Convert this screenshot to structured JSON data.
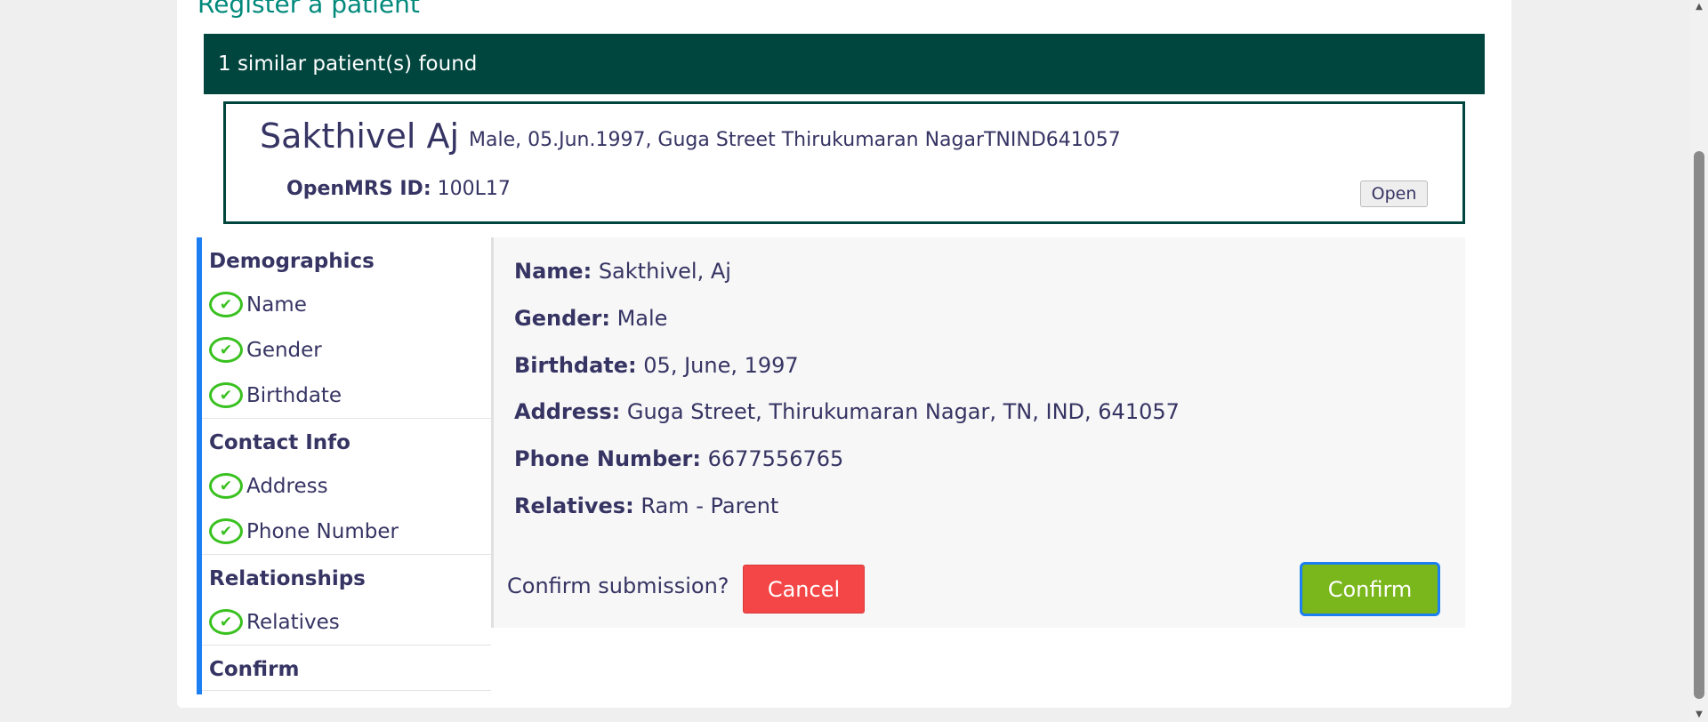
{
  "page": {
    "title": "Register a patient"
  },
  "similar": {
    "banner": "1 similar patient(s) found",
    "name": "Sakthivel Aj",
    "info": "Male, 05.Jun.1997, Guga Street Thirukumaran NagarTNIND641057",
    "id_label": "OpenMRS ID:",
    "id_value": "100L17",
    "open_label": "Open"
  },
  "nav": {
    "sections": [
      {
        "title": "Demographics",
        "items": [
          "Name",
          "Gender",
          "Birthdate"
        ]
      },
      {
        "title": "Contact Info",
        "items": [
          "Address",
          "Phone Number"
        ]
      },
      {
        "title": "Relationships",
        "items": [
          "Relatives"
        ]
      },
      {
        "title": "Confirm",
        "items": []
      }
    ]
  },
  "summary": {
    "fields": [
      {
        "label": "Name:",
        "value": "Sakthivel, Aj"
      },
      {
        "label": "Gender:",
        "value": "Male"
      },
      {
        "label": "Birthdate:",
        "value": "05, June, 1997"
      },
      {
        "label": "Address:",
        "value": "Guga Street, Thirukumaran Nagar, TN, IND, 641057"
      },
      {
        "label": "Phone Number:",
        "value": "6677556765"
      },
      {
        "label": "Relatives:",
        "value": "Ram - Parent"
      }
    ],
    "confirm_question": "Confirm submission?",
    "cancel_label": "Cancel",
    "confirm_label": "Confirm"
  },
  "icons": {
    "check": "check-circle-icon"
  },
  "colors": {
    "accent": "#00897b",
    "banner": "#00463f",
    "check": "#39c11f",
    "cancel": "#f44646",
    "confirm": "#7ab71d",
    "focus": "#1c7ff2"
  }
}
